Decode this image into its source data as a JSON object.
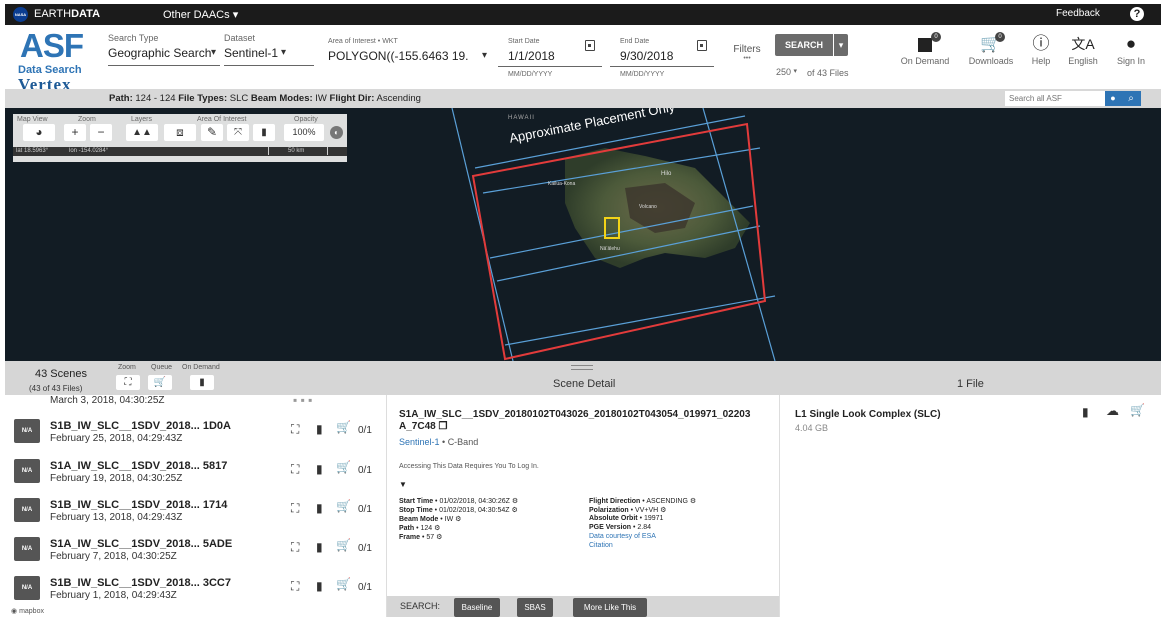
{
  "topbar": {
    "nasa": "NASA",
    "brand_a": "EARTH",
    "brand_b": "DATA",
    "other_daacs": "Other DAACs",
    "feedback": "Feedback",
    "help_glyph": "?"
  },
  "logo": {
    "asf": "ASF",
    "data_search": "Data Search",
    "vertex": "Vertex"
  },
  "search": {
    "search_type_label": "Search Type",
    "search_type_value": "Geographic Search",
    "dataset_label": "Dataset",
    "dataset_value": "Sentinel-1",
    "aoi_label": "Area of Interest • WKT",
    "aoi_value": "POLYGON((-155.6463 19.",
    "start_label": "Start Date",
    "start_value": "1/1/2018",
    "start_hint": "MM/DD/YYYY",
    "end_label": "End Date",
    "end_value": "9/30/2018",
    "end_hint": "MM/DD/YYYY",
    "filters": "Filters",
    "filters_more": "•••",
    "search_button": "SEARCH",
    "max_results": "250",
    "of_files": "of 43 Files"
  },
  "nav": {
    "on_demand": "On Demand",
    "on_demand_count": "0",
    "downloads": "Downloads",
    "downloads_count": "0",
    "help": "Help",
    "english": "English",
    "sign_in": "Sign In"
  },
  "infobar": {
    "path_label": "Path:",
    "path_value": "124 - 124",
    "file_types_label": "File Types:",
    "file_types_value": "SLC",
    "beam_label": "Beam Modes:",
    "beam_value": "IW",
    "flight_label": "Flight Dir:",
    "flight_value": "Ascending",
    "search_all_placeholder": "Search all ASF"
  },
  "maptools": {
    "map_view": "Map View",
    "zoom": "Zoom",
    "layers": "Layers",
    "aoi": "Area Of Interest",
    "opacity": "Opacity",
    "opacity_value": "100%",
    "lat": "lat 18.5963°",
    "lon": "lon -154.0284°",
    "scale": "50 km"
  },
  "map": {
    "hawaii": "HAWAII",
    "placement": "Approximate Placement Only",
    "hilo": "Hilo",
    "kailua": "Kailua-Kona",
    "volcano": "Volcano",
    "naalehu": "Nāʻālehu"
  },
  "results": {
    "scenes": "43 Scenes",
    "of_files": "(43 of 43 Files)",
    "zoom": "Zoom",
    "queue": "Queue",
    "on_demand": "On Demand",
    "scene_detail": "Scene Detail",
    "file_count": "1 File"
  },
  "rows": [
    {
      "title": "",
      "date": "March 3, 2018, 04:30:25Z",
      "na": ""
    },
    {
      "title": "S1B_IW_SLC__1SDV_2018... 1D0A",
      "date": "February 25, 2018, 04:29:43Z",
      "na": "N/A",
      "queue": "0/1"
    },
    {
      "title": "S1A_IW_SLC__1SDV_2018... 5817",
      "date": "February 19, 2018, 04:30:25Z",
      "na": "N/A",
      "queue": "0/1"
    },
    {
      "title": "S1B_IW_SLC__1SDV_2018... 1714",
      "date": "February 13, 2018, 04:29:43Z",
      "na": "N/A",
      "queue": "0/1"
    },
    {
      "title": "S1A_IW_SLC__1SDV_2018... 5ADE",
      "date": "February 7, 2018, 04:30:25Z",
      "na": "N/A",
      "queue": "0/1"
    },
    {
      "title": "S1B_IW_SLC__1SDV_2018... 3CC7",
      "date": "February 1, 2018, 04:29:43Z",
      "na": "N/A",
      "queue": "0/1"
    }
  ],
  "detail": {
    "title_1": "S1A_IW_SLC__1SDV_20180102T043026_20180102T043054_019971_02203",
    "title_2": "A_7C48",
    "platform": "Sentinel-1",
    "band": "C-Band",
    "login_note": "Accessing This Data Requires You To Log In.",
    "start_time_k": "Start Time",
    "start_time_v": "01/02/2018, 04:30:26Z",
    "stop_time_k": "Stop Time",
    "stop_time_v": "01/02/2018, 04:30:54Z",
    "beam_mode_k": "Beam Mode",
    "beam_mode_v": "IW",
    "path_k": "Path",
    "path_v": "124",
    "frame_k": "Frame",
    "frame_v": "57",
    "flight_dir_k": "Flight Direction",
    "flight_dir_v": "ASCENDING",
    "polarization_k": "Polarization",
    "polarization_v": "VV+VH",
    "abs_orbit_k": "Absolute Orbit",
    "abs_orbit_v": "19971",
    "pge_k": "PGE Version",
    "pge_v": "2.84",
    "data_courtesy": "Data courtesy of ESA",
    "citation": "Citation",
    "search_label": "SEARCH:",
    "baseline": "Baseline",
    "sbas": "SBAS",
    "more_like": "More Like This"
  },
  "file": {
    "name": "L1 Single Look Complex (SLC)",
    "size": "4.04 GB"
  },
  "mapbox": "mapbox"
}
